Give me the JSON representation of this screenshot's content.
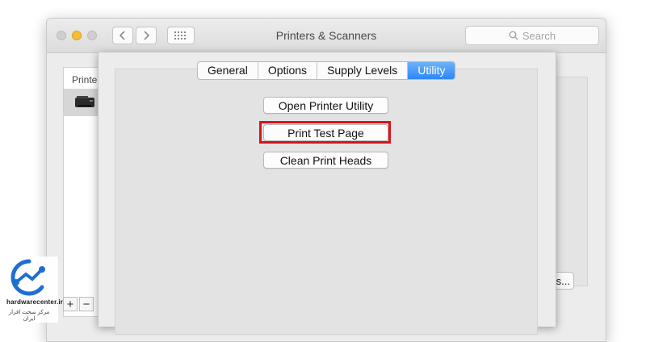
{
  "window": {
    "title": "Printers & Scanners",
    "search_placeholder": "Search"
  },
  "list": {
    "header": "Printer",
    "add_label": "+",
    "remove_label": "−"
  },
  "tabs": [
    {
      "label": "General",
      "active": false
    },
    {
      "label": "Options",
      "active": false
    },
    {
      "label": "Supply Levels",
      "active": false
    },
    {
      "label": "Utility",
      "active": true
    }
  ],
  "utility": {
    "open_printer_utility": "Open Printer Utility",
    "print_test_page": "Print Test Page",
    "clean_print_heads": "Clean Print Heads"
  },
  "behind": {
    "button_label": "s..."
  },
  "colors": {
    "accent": "#2e86f5",
    "highlight": "#d9141b",
    "watermark": "#1f6fd1"
  },
  "watermark": {
    "brand": "hardwarecenter.ir",
    "tagline": "مرکز سخت افزار ایران"
  }
}
